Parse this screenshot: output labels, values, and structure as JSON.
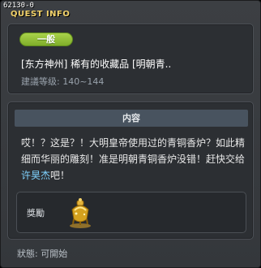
{
  "window": {
    "quest_id": "62130-0",
    "title": "QUEST INFO"
  },
  "quest": {
    "category_badge": "一般",
    "name": "[东方神州] 稀有的收藏品 [明朝青..",
    "level_label": "建議等级: 140~144"
  },
  "content": {
    "heading": "内容",
    "desc_part1": "哎！？这是？！大明皇帝使用过的青铜香炉？如此精细而华丽的雕刻！准是明朝青铜香炉没错！赶快交给",
    "desc_highlight": "许昊杰",
    "desc_part2": "吧！"
  },
  "reward": {
    "label": "獎勵",
    "item_icon": "gold-incense-burner-icon"
  },
  "footer": {
    "status": "狀態: 可開始"
  },
  "colors": {
    "title": "#f2d26a",
    "badge": "#8fbe34",
    "highlight": "#7fd3ff"
  }
}
